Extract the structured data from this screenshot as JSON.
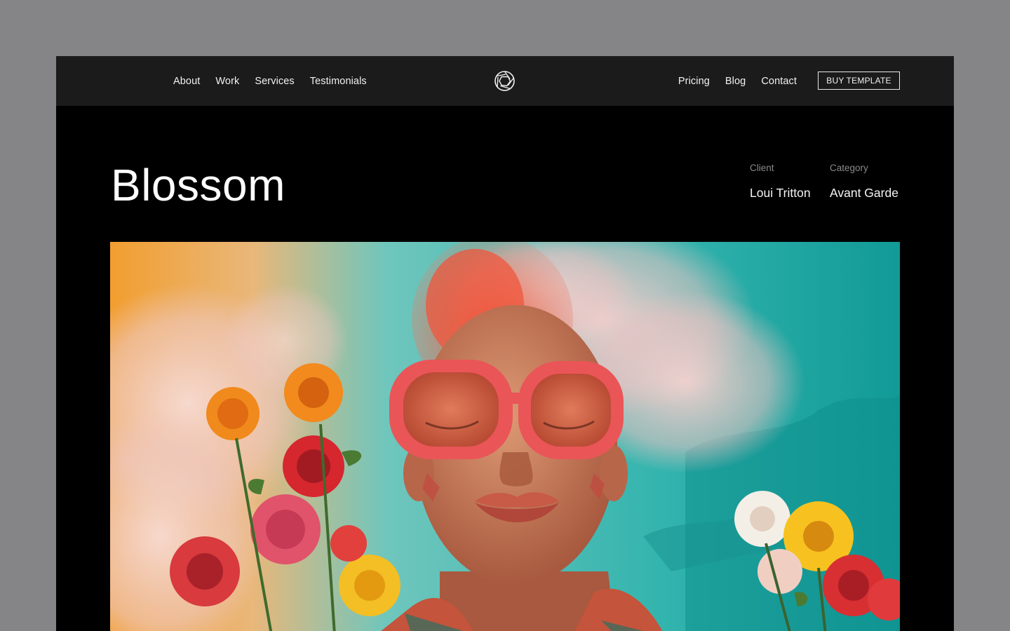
{
  "nav": {
    "left_links": [
      "About",
      "Work",
      "Services",
      "Testimonials"
    ],
    "right_links": [
      "Pricing",
      "Blog",
      "Contact"
    ],
    "buy_button": "BUY TEMPLATE",
    "logo_icon": "aperture-icon"
  },
  "project": {
    "title": "Blossom",
    "client_label": "Client",
    "client_value": "Loui Tritton",
    "category_label": "Category",
    "category_value": "Avant Garde"
  },
  "hero": {
    "image": "fashion-portrait-photo",
    "palette": {
      "sky_teal": "#2fb3ae",
      "orange": "#f3a435",
      "smoke_pink": "#f1c9c7",
      "glasses_red": "#ea5558",
      "skin": "#c7805d",
      "hair": "#f0553c"
    }
  },
  "colors": {
    "outer_background": "#858587",
    "navbar": "#1b1b1b",
    "page": "#000000",
    "text": "#ffffff",
    "muted": "#8a8a8a"
  }
}
